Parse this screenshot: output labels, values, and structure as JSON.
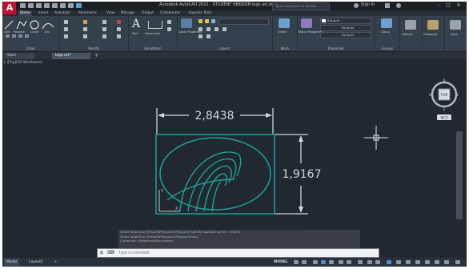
{
  "app": {
    "logo": "A",
    "title": "Autodesk AutoCAD 2021 - STUDENT VERSION    logo art.dwg",
    "search_placeholder": "Type a keyword or phrase",
    "signin": "Sign In",
    "window_buttons": [
      "–",
      "□",
      "✕"
    ]
  },
  "ribbon_tabs": [
    "Home",
    "Insert",
    "Annotate",
    "Parametric",
    "View",
    "Manage",
    "Output",
    "Collaborate",
    "Express Tools"
  ],
  "ribbon": {
    "panels": [
      "Draw",
      "Modify",
      "Annotation",
      "Layers",
      "Block",
      "Properties",
      "Groups"
    ],
    "draw_tools": [
      "Line",
      "Polyline",
      "Circle",
      "Arc"
    ],
    "annotation_tools": [
      "Text",
      "Dimension"
    ],
    "layer_tool": "Layer Properties",
    "block_tool": "Insert",
    "match_tool": "Match Properties",
    "bylayer": [
      "ByLayer",
      "ByLayer",
      "ByLayer"
    ],
    "group_tool": "Group",
    "utilities_tool": "Utilities",
    "clipboard_tool": "Clipboard",
    "view_tool": "View"
  },
  "doc_tabs": [
    "Start",
    "logo art*"
  ],
  "viewport_label": "[-][Top][2D Wireframe]",
  "viewcube": {
    "face": "TOP",
    "n": "N",
    "s": "S",
    "e": "E",
    "w": "W",
    "wcs": "WCS"
  },
  "drawing": {
    "width_dimension": "2,8438",
    "height_dimension": "1,9167",
    "ucs_y": "Y",
    "ucs_x": "X"
  },
  "command": {
    "history": [
      "Select objects or [Fence/WPolygon/CPolygon]: Specify opposite corner: 1 found",
      "Select objects or [Fence/WPolygon/CPolygon/Undo]:",
      "Command:  <Regenerating model>"
    ],
    "prompt_icon": "⌨",
    "placeholder": "Type a command"
  },
  "status_tabs": [
    "Model",
    "Layout1",
    "+"
  ],
  "status_right": "MODEL",
  "colors": {
    "drawing_cyan": "#1aa39a",
    "dimension": "#d2d6da",
    "background": "#212830"
  }
}
